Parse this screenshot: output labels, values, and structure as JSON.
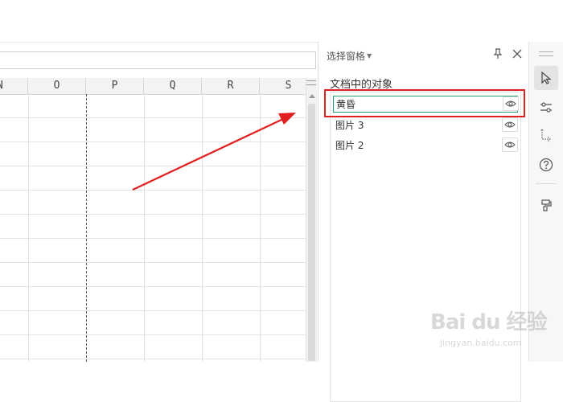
{
  "spreadsheet": {
    "columns": [
      "N",
      "O",
      "P",
      "Q",
      "R",
      "S"
    ]
  },
  "selection_pane": {
    "title": "选择窗格",
    "section_label": "文档中的对象",
    "objects": [
      {
        "name": "黄昏",
        "selected": true,
        "visible": true
      },
      {
        "name": "图片 3",
        "selected": false,
        "visible": true
      },
      {
        "name": "图片 2",
        "selected": false,
        "visible": true
      }
    ]
  },
  "right_rail": {
    "icons": [
      "pointer-icon",
      "sliders-icon",
      "swap-icon",
      "help-icon",
      "paint-icon"
    ]
  },
  "annotation": {
    "highlight_color": "#e02020",
    "arrow_color": "#e02020"
  },
  "watermark": {
    "main": "Bai du 经验",
    "sub": "jingyan.baidu.com"
  },
  "colors": {
    "selected_border": "#22a06b",
    "header_bg": "#f3f3f3"
  }
}
